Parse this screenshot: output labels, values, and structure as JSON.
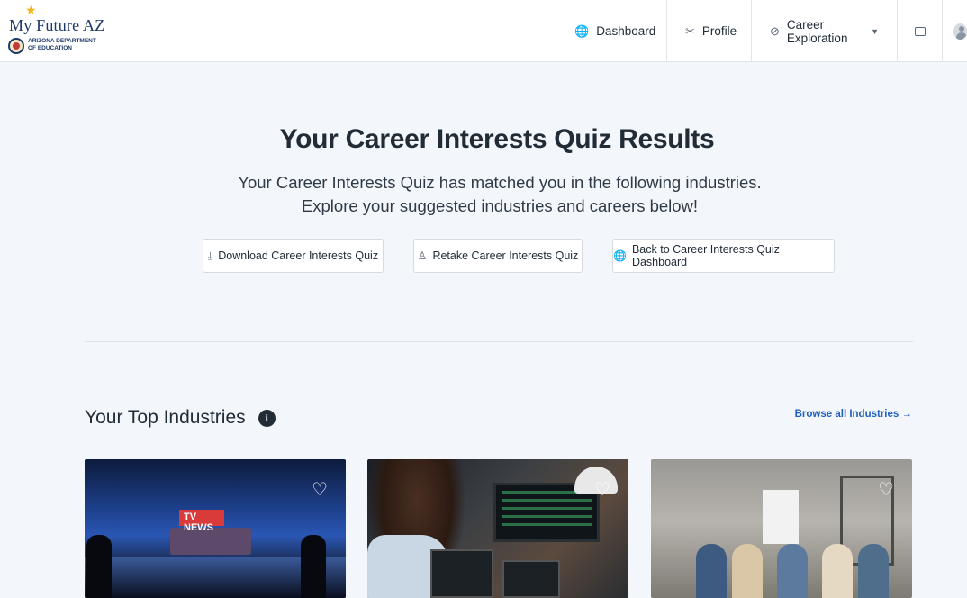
{
  "header": {
    "logo": {
      "brand": "My Future AZ",
      "dept": "ARIZONA DEPARTMENT\nOF EDUCATION"
    },
    "nav": {
      "dashboard": "Dashboard",
      "profile": "Profile",
      "career_exploration": "Career Exploration"
    }
  },
  "hero": {
    "title": "Your Career Interests Quiz Results",
    "subtitle": "Your Career Interests Quiz has matched you in the following industries. Explore your suggested industries and careers below!",
    "buttons": {
      "download": "Download Career Interests Quiz",
      "retake": "Retake Career Interests Quiz",
      "back": "Back to Career Interests Quiz Dashboard"
    }
  },
  "industries": {
    "title": "Your Top Industries",
    "browse_link": "Browse all Industries →",
    "card1_screen_text": "TV NEWS"
  },
  "colors": {
    "accent_link": "#1f5fbf",
    "page_bg": "#f3f6fa",
    "text_dark": "#222c37"
  },
  "icons": {
    "dashboard": "globe-icon",
    "profile": "tools-icon",
    "career": "compass-icon",
    "inbox": "inbox-icon",
    "user": "user-avatar-icon",
    "download": "download-icon",
    "retake": "user-retake-icon",
    "back": "globe-icon",
    "info": "info-icon",
    "favorite": "heart-icon"
  }
}
